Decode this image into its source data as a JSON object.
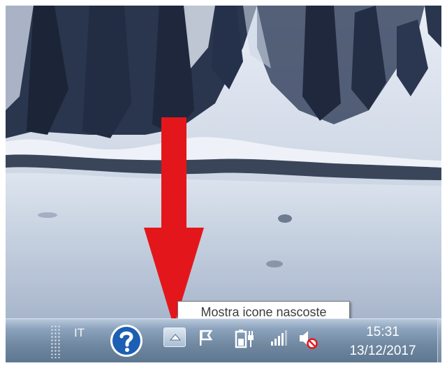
{
  "taskbar": {
    "language": "IT",
    "tray_icons": [
      "help-icon",
      "chevron-up-icon",
      "flag-icon",
      "battery-charging-icon",
      "network-signal-icon",
      "speaker-muted-icon"
    ],
    "clock": {
      "time": "15:31",
      "date": "13/12/2017"
    }
  },
  "tooltip": {
    "text": "Mostra icone nascoste"
  },
  "colors": {
    "arrow": "#e3171b",
    "help_blue": "#1c5fb3",
    "taskbar": "#7189a3"
  }
}
